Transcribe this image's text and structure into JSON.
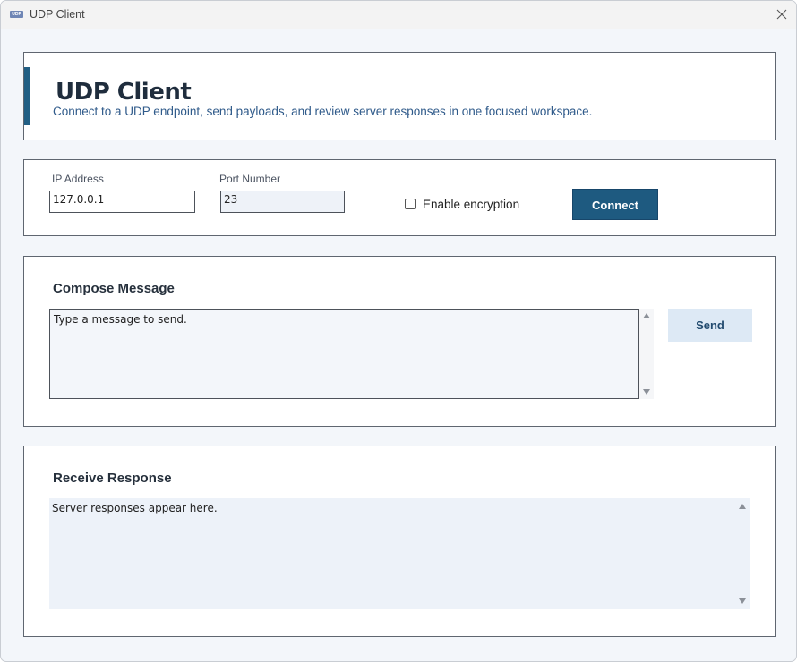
{
  "window": {
    "app_icon_text": "UDP",
    "title": "UDP Client"
  },
  "header": {
    "title": "UDP Client",
    "subtitle": "Connect to a UDP endpoint, send payloads, and review server responses in one focused workspace."
  },
  "connection": {
    "ip_label": "IP Address",
    "ip_value": "127.0.0.1",
    "port_label": "Port Number",
    "port_value": "23",
    "encryption_label": "Enable encryption",
    "encryption_checked": false,
    "connect_label": "Connect"
  },
  "compose": {
    "title": "Compose Message",
    "message_text": "Type a message to send.",
    "send_label": "Send"
  },
  "receive": {
    "title": "Receive Response",
    "response_text": "Server responses appear here."
  },
  "colors": {
    "accent": "#215f84",
    "connect_button": "#1e5a80",
    "send_button_bg": "#dde9f5",
    "background": "#f3f6fa"
  },
  "icons": {
    "close": "close-icon",
    "checkbox": "checkbox-icon",
    "scroll_up": "chevron-up-icon",
    "scroll_down": "chevron-down-icon"
  }
}
